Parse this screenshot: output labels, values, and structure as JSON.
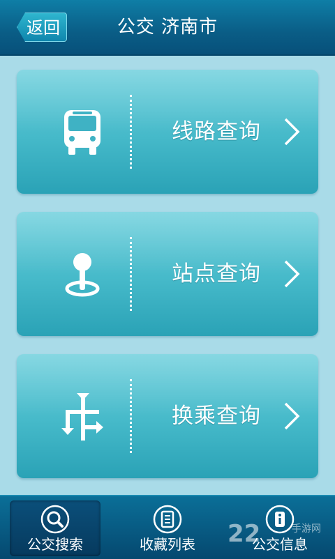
{
  "header": {
    "back_label": "返回",
    "title": "公交 济南市"
  },
  "cards": [
    {
      "label": "线路查询",
      "icon": "bus-icon"
    },
    {
      "label": "站点查询",
      "icon": "map-pin-icon"
    },
    {
      "label": "换乘查询",
      "icon": "transfer-icon"
    }
  ],
  "tabs": [
    {
      "label": "公交搜索",
      "icon": "search-icon",
      "active": true
    },
    {
      "label": "收藏列表",
      "icon": "favorites-list-icon",
      "active": false
    },
    {
      "label": "公交信息",
      "icon": "info-icon",
      "active": false
    }
  ],
  "watermark": {
    "number": "22",
    "text": "手游网"
  },
  "colors": {
    "header": "#0a5d86",
    "background": "#a9dbe8",
    "card": "#45b9c9",
    "tabbar": "#05486f"
  }
}
